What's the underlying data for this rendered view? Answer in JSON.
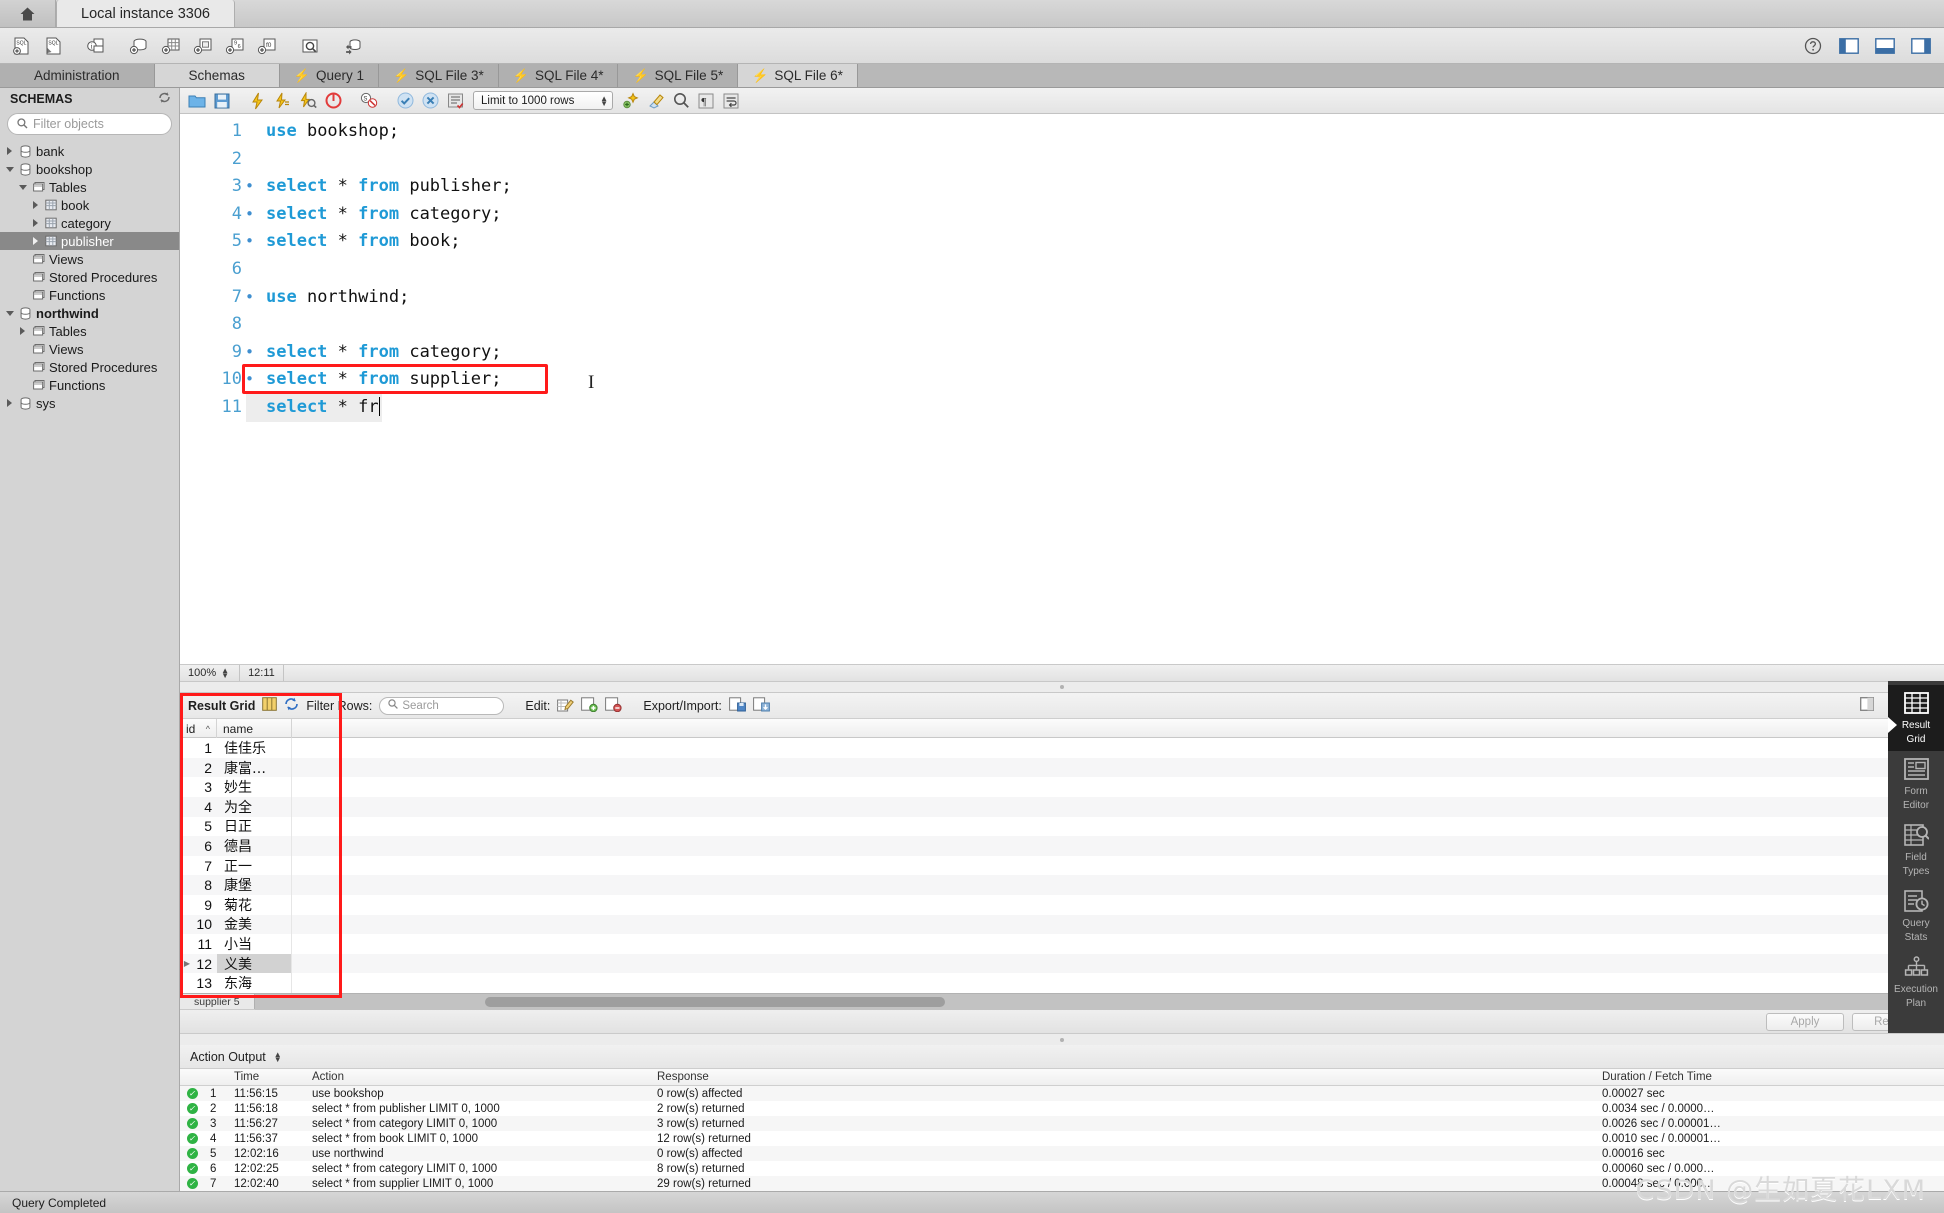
{
  "titlebar": {
    "home_icon": "home-icon",
    "instance_tab": "Local instance 3306"
  },
  "main_toolbar": {
    "buttons": [
      {
        "name": "new-sql-tab-icon",
        "title": "New SQL tab"
      },
      {
        "name": "open-sql-script-icon",
        "title": "Open SQL script"
      },
      {
        "name": "new-connection-icon",
        "title": "New connection"
      },
      {
        "name": "new-schema-icon",
        "title": "Create new schema"
      },
      {
        "name": "new-table-icon",
        "title": "Create new table"
      },
      {
        "name": "new-view-icon",
        "title": "Create new view"
      },
      {
        "name": "new-procedure-icon",
        "title": "Create new stored procedure"
      },
      {
        "name": "new-function-icon",
        "title": "Create new function"
      },
      {
        "name": "search-data-icon",
        "title": "Search table data"
      },
      {
        "name": "reconnect-server-icon",
        "title": "Reconnect to server"
      }
    ],
    "right_buttons": [
      {
        "name": "help-icon"
      },
      {
        "name": "toggle-sidebar-icon"
      },
      {
        "name": "toggle-output-icon"
      },
      {
        "name": "toggle-secondary-sidebar-icon"
      }
    ]
  },
  "tabs": [
    {
      "label": "Administration",
      "icon": "",
      "active": false
    },
    {
      "label": "Schemas",
      "icon": "",
      "active": true
    },
    {
      "label": "Query 1",
      "icon": "bolt-icon",
      "active": false
    },
    {
      "label": "SQL File 3*",
      "icon": "bolt-icon",
      "active": false
    },
    {
      "label": "SQL File 4*",
      "icon": "bolt-icon",
      "active": false
    },
    {
      "label": "SQL File 5*",
      "icon": "bolt-icon",
      "active": false
    },
    {
      "label": "SQL File 6*",
      "icon": "bolt-icon",
      "active": true
    }
  ],
  "sidebar": {
    "header": "SCHEMAS",
    "refresh_icon": "refresh-icon",
    "search": {
      "placeholder": "Filter objects",
      "value": "",
      "icon": "search-icon"
    },
    "tree": [
      {
        "label": "bank",
        "indent": 0,
        "twisty": "right",
        "icon": "schema-icon",
        "bold": false,
        "selected": false
      },
      {
        "label": "bookshop",
        "indent": 0,
        "twisty": "down",
        "icon": "schema-icon",
        "bold": false,
        "selected": false
      },
      {
        "label": "Tables",
        "indent": 1,
        "twisty": "down",
        "icon": "folder-icon",
        "bold": false,
        "selected": false
      },
      {
        "label": "book",
        "indent": 2,
        "twisty": "right",
        "icon": "table-icon",
        "bold": false,
        "selected": false
      },
      {
        "label": "category",
        "indent": 2,
        "twisty": "right",
        "icon": "table-icon",
        "bold": false,
        "selected": false
      },
      {
        "label": "publisher",
        "indent": 2,
        "twisty": "right",
        "icon": "table-icon",
        "bold": false,
        "selected": true
      },
      {
        "label": "Views",
        "indent": 1,
        "twisty": "none",
        "icon": "folder-icon",
        "bold": false,
        "selected": false
      },
      {
        "label": "Stored Procedures",
        "indent": 1,
        "twisty": "none",
        "icon": "folder-icon",
        "bold": false,
        "selected": false
      },
      {
        "label": "Functions",
        "indent": 1,
        "twisty": "none",
        "icon": "folder-icon",
        "bold": false,
        "selected": false
      },
      {
        "label": "northwind",
        "indent": 0,
        "twisty": "down",
        "icon": "schema-icon",
        "bold": true,
        "selected": false
      },
      {
        "label": "Tables",
        "indent": 1,
        "twisty": "right",
        "icon": "folder-icon",
        "bold": false,
        "selected": false
      },
      {
        "label": "Views",
        "indent": 1,
        "twisty": "none",
        "icon": "folder-icon",
        "bold": false,
        "selected": false
      },
      {
        "label": "Stored Procedures",
        "indent": 1,
        "twisty": "none",
        "icon": "folder-icon",
        "bold": false,
        "selected": false
      },
      {
        "label": "Functions",
        "indent": 1,
        "twisty": "none",
        "icon": "folder-icon",
        "bold": false,
        "selected": false
      },
      {
        "label": "sys",
        "indent": 0,
        "twisty": "right",
        "icon": "schema-icon",
        "bold": false,
        "selected": false
      }
    ]
  },
  "editor_toolbar": {
    "buttons": [
      {
        "name": "open-file-icon"
      },
      {
        "name": "save-file-icon"
      },
      {
        "name": "execute-script-icon"
      },
      {
        "name": "execute-statement-icon"
      },
      {
        "name": "explain-statement-icon"
      },
      {
        "name": "stop-execution-icon"
      },
      {
        "name": "toggle-stop-on-error-icon"
      },
      {
        "name": "commit-icon"
      },
      {
        "name": "rollback-icon"
      },
      {
        "name": "autocommit-icon"
      },
      {
        "name": "beautify-sql-icon"
      },
      {
        "name": "find-icon"
      },
      {
        "name": "toggle-invisible-chars-icon"
      },
      {
        "name": "wrap-lines-icon"
      }
    ],
    "limit_select": {
      "value": "Limit to 1000 rows"
    }
  },
  "editor": {
    "lines": [
      {
        "num": "1",
        "exec_marker": false,
        "tokens": [
          {
            "t": "use",
            "k": true
          },
          {
            "t": " bookshop;",
            "k": false
          }
        ]
      },
      {
        "num": "2",
        "exec_marker": false,
        "tokens": []
      },
      {
        "num": "3",
        "exec_marker": true,
        "tokens": [
          {
            "t": "select",
            "k": true
          },
          {
            "t": " * ",
            "k": false
          },
          {
            "t": "from",
            "k": true
          },
          {
            "t": " publisher;",
            "k": false
          }
        ]
      },
      {
        "num": "4",
        "exec_marker": true,
        "tokens": [
          {
            "t": "select",
            "k": true
          },
          {
            "t": " * ",
            "k": false
          },
          {
            "t": "from",
            "k": true
          },
          {
            "t": " category;",
            "k": false
          }
        ]
      },
      {
        "num": "5",
        "exec_marker": true,
        "tokens": [
          {
            "t": "select",
            "k": true
          },
          {
            "t": " * ",
            "k": false
          },
          {
            "t": "from",
            "k": true
          },
          {
            "t": " book;",
            "k": false
          }
        ]
      },
      {
        "num": "6",
        "exec_marker": false,
        "tokens": []
      },
      {
        "num": "7",
        "exec_marker": true,
        "tokens": [
          {
            "t": "use",
            "k": true
          },
          {
            "t": " northwind;",
            "k": false
          }
        ]
      },
      {
        "num": "8",
        "exec_marker": false,
        "tokens": []
      },
      {
        "num": "9",
        "exec_marker": true,
        "tokens": [
          {
            "t": "select",
            "k": true
          },
          {
            "t": " * ",
            "k": false
          },
          {
            "t": "from",
            "k": true
          },
          {
            "t": " category;",
            "k": false
          }
        ]
      },
      {
        "num": "10",
        "exec_marker": true,
        "tokens": [
          {
            "t": "select",
            "k": true
          },
          {
            "t": " * ",
            "k": false
          },
          {
            "t": "from",
            "k": true
          },
          {
            "t": " supplier;",
            "k": false
          }
        ],
        "highlighted": true
      },
      {
        "num": "11",
        "exec_marker": false,
        "tokens": [
          {
            "t": "select",
            "k": true
          },
          {
            "t": " * fr",
            "k": false
          }
        ],
        "current": true,
        "caret": true
      }
    ],
    "highlight_color": "#ff1a1a"
  },
  "editor_status": {
    "zoom": "100%",
    "position": "12:11"
  },
  "results": {
    "toolbar": {
      "title": "Result Grid",
      "grid_view_icon": "grid-view-icon",
      "refresh_icon": "refresh-grid-icon",
      "filter_label": "Filter Rows:",
      "filter_placeholder": "Search",
      "filter_value": "",
      "edit_label": "Edit:",
      "edit_icons": [
        "edit-row-icon",
        "insert-row-icon",
        "delete-row-icon"
      ],
      "exportimport_label": "Export/Import:",
      "exportimport_icons": [
        "export-recordset-icon",
        "import-recordset-icon"
      ],
      "wrap-cell-icon": "wrap-cell-content-icon"
    },
    "columns": [
      "id",
      "name"
    ],
    "sort_indicator": "^",
    "rows": [
      {
        "id": "1",
        "name": "佳佳乐",
        "selected": false
      },
      {
        "id": "2",
        "name": "康富…",
        "selected": false
      },
      {
        "id": "3",
        "name": "妙生",
        "selected": false
      },
      {
        "id": "4",
        "name": "为全",
        "selected": false
      },
      {
        "id": "5",
        "name": "日正",
        "selected": false
      },
      {
        "id": "6",
        "name": "德昌",
        "selected": false
      },
      {
        "id": "7",
        "name": "正一",
        "selected": false
      },
      {
        "id": "8",
        "name": "康堡",
        "selected": false
      },
      {
        "id": "9",
        "name": "菊花",
        "selected": false
      },
      {
        "id": "10",
        "name": "金美",
        "selected": false
      },
      {
        "id": "11",
        "name": "小当",
        "selected": false
      },
      {
        "id": "12",
        "name": "义美",
        "selected": true
      },
      {
        "id": "13",
        "name": "东海",
        "selected": false
      }
    ],
    "result_tab": "supplier 5",
    "apply_label": "Apply",
    "revert_label": "Revert"
  },
  "right_panel": {
    "items": [
      {
        "label_line1": "Result",
        "label_line2": "Grid",
        "icon": "result-grid-icon",
        "active": true
      },
      {
        "label_line1": "Form",
        "label_line2": "Editor",
        "icon": "form-editor-icon",
        "active": false
      },
      {
        "label_line1": "Field",
        "label_line2": "Types",
        "icon": "field-types-icon",
        "active": false
      },
      {
        "label_line1": "Query",
        "label_line2": "Stats",
        "icon": "query-stats-icon",
        "active": false
      },
      {
        "label_line1": "Execution",
        "label_line2": "Plan",
        "icon": "execution-plan-icon",
        "active": false
      }
    ]
  },
  "action_output": {
    "title": "Action Output",
    "columns": [
      "",
      "",
      "Time",
      "Action",
      "Response",
      "Duration / Fetch Time"
    ],
    "rows": [
      {
        "num": "1",
        "time": "11:56:15",
        "action": "use bookshop",
        "response": "0 row(s) affected",
        "duration": "0.00027 sec",
        "status": "ok"
      },
      {
        "num": "2",
        "time": "11:56:18",
        "action": "select * from publisher LIMIT 0, 1000",
        "response": "2 row(s) returned",
        "duration": "0.0034 sec / 0.0000…",
        "status": "ok"
      },
      {
        "num": "3",
        "time": "11:56:27",
        "action": "select * from category LIMIT 0, 1000",
        "response": "3 row(s) returned",
        "duration": "0.0026 sec / 0.00001…",
        "status": "ok"
      },
      {
        "num": "4",
        "time": "11:56:37",
        "action": "select * from book LIMIT 0, 1000",
        "response": "12 row(s) returned",
        "duration": "0.0010 sec / 0.00001…",
        "status": "ok"
      },
      {
        "num": "5",
        "time": "12:02:16",
        "action": "use northwind",
        "response": "0 row(s) affected",
        "duration": "0.00016 sec",
        "status": "ok"
      },
      {
        "num": "6",
        "time": "12:02:25",
        "action": "select * from category LIMIT 0, 1000",
        "response": "8 row(s) returned",
        "duration": "0.00060 sec / 0.000…",
        "status": "ok"
      },
      {
        "num": "7",
        "time": "12:02:40",
        "action": "select * from supplier LIMIT 0, 1000",
        "response": "29 row(s) returned",
        "duration": "0.00048 sec / 0.000…",
        "status": "ok"
      }
    ]
  },
  "status_bar": {
    "message": "Query Completed"
  },
  "watermark": "CSDN @生如夏花LXM"
}
